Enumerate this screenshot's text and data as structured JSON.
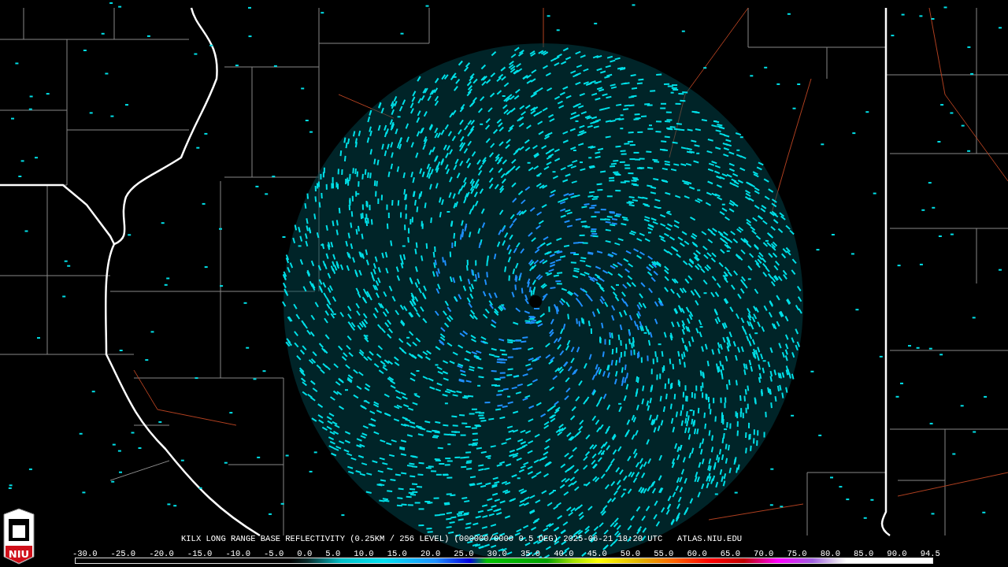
{
  "caption": "KILX LONG RANGE BASE REFLECTIVITY (0.25KM / 256 LEVEL) (000000/0000 0.5 DEG) 2025-06-21 18:20 UTC   ATLAS.NIU.EDU",
  "logo": {
    "text": "NIU"
  },
  "color_scale": {
    "labels": [
      "-30.0",
      "-25.0",
      "-20.0",
      "-15.0",
      "-10.0",
      "-5.0",
      "0.0",
      "5.0",
      "10.0",
      "15.0",
      "20.0",
      "25.0",
      "30.0",
      "35.0",
      "40.0",
      "45.0",
      "50.0",
      "55.0",
      "60.0",
      "65.0",
      "70.0",
      "75.0",
      "80.0",
      "85.0",
      "90.0",
      "94.5"
    ]
  }
}
